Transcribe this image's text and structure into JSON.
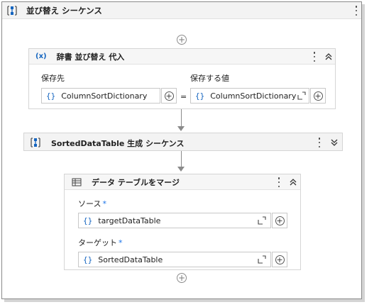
{
  "sequence": {
    "title": "並び替え シーケンス"
  },
  "assign": {
    "icon_text": "(x)",
    "title": "辞書 並び替え 代入",
    "target_label": "保存先",
    "target_value": "ColumnSortDictionary",
    "equals": "=",
    "value_label": "保存する値",
    "value_value": "ColumnSortDictionary",
    "brace": "{}"
  },
  "sub_sequence": {
    "title": "SortedDataTable 生成 シーケンス"
  },
  "merge": {
    "title": "データ テーブルをマージ",
    "source_label": "ソース",
    "source_required": "*",
    "source_value": "targetDataTable",
    "target_label": "ターゲット",
    "target_required": "*",
    "target_value": "SortedDataTable",
    "brace": "{}"
  },
  "plus_symbol": "+"
}
